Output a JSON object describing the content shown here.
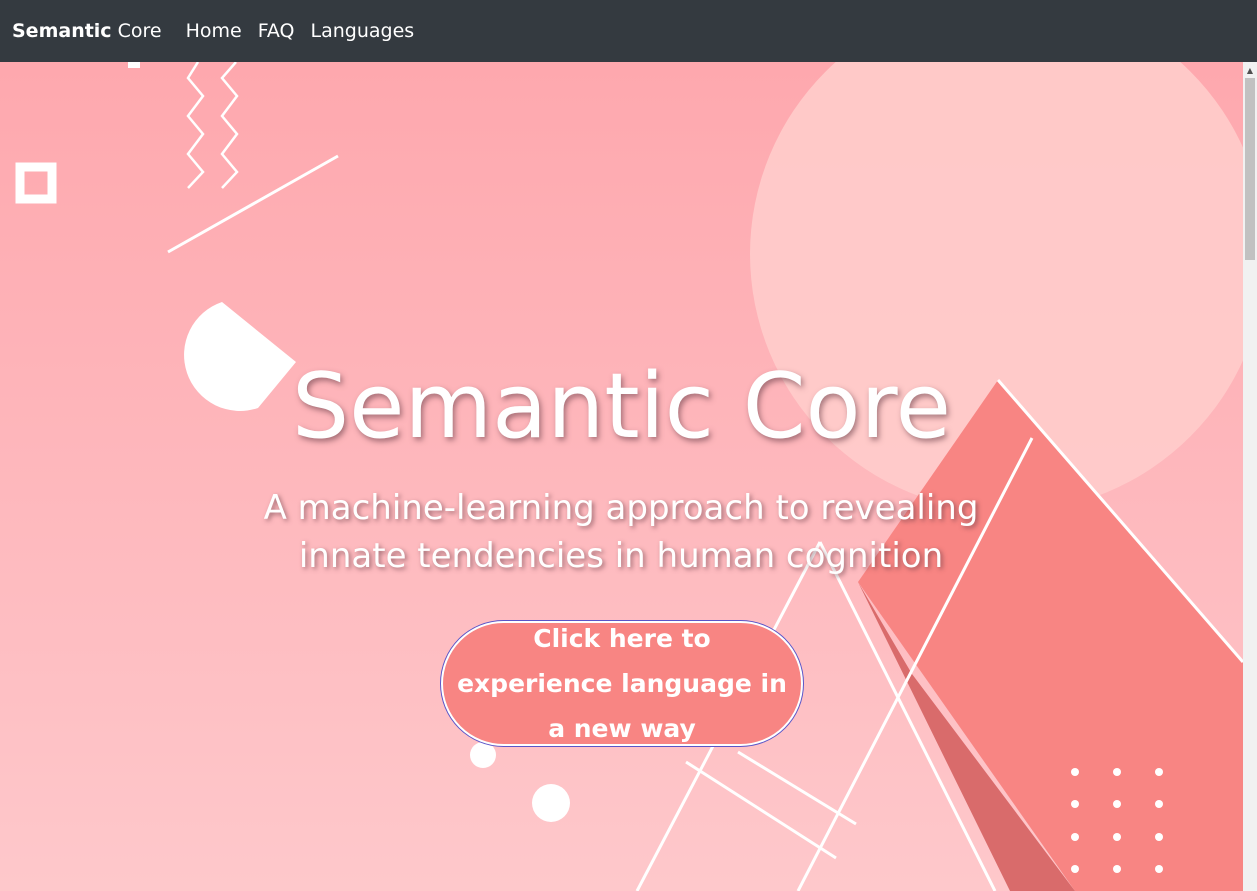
{
  "navbar": {
    "brand_bold": "Semantic",
    "brand_rest": " Core",
    "links": [
      {
        "label": "Home"
      },
      {
        "label": "FAQ"
      },
      {
        "label": "Languages"
      }
    ]
  },
  "hero": {
    "title": "Semantic Core",
    "subtitle": "A machine-learning approach to revealing innate tendencies in human cognition",
    "cta_label": "Click here to experience language in a new way"
  },
  "icons": {
    "scroll_up": "up-arrow-icon"
  }
}
